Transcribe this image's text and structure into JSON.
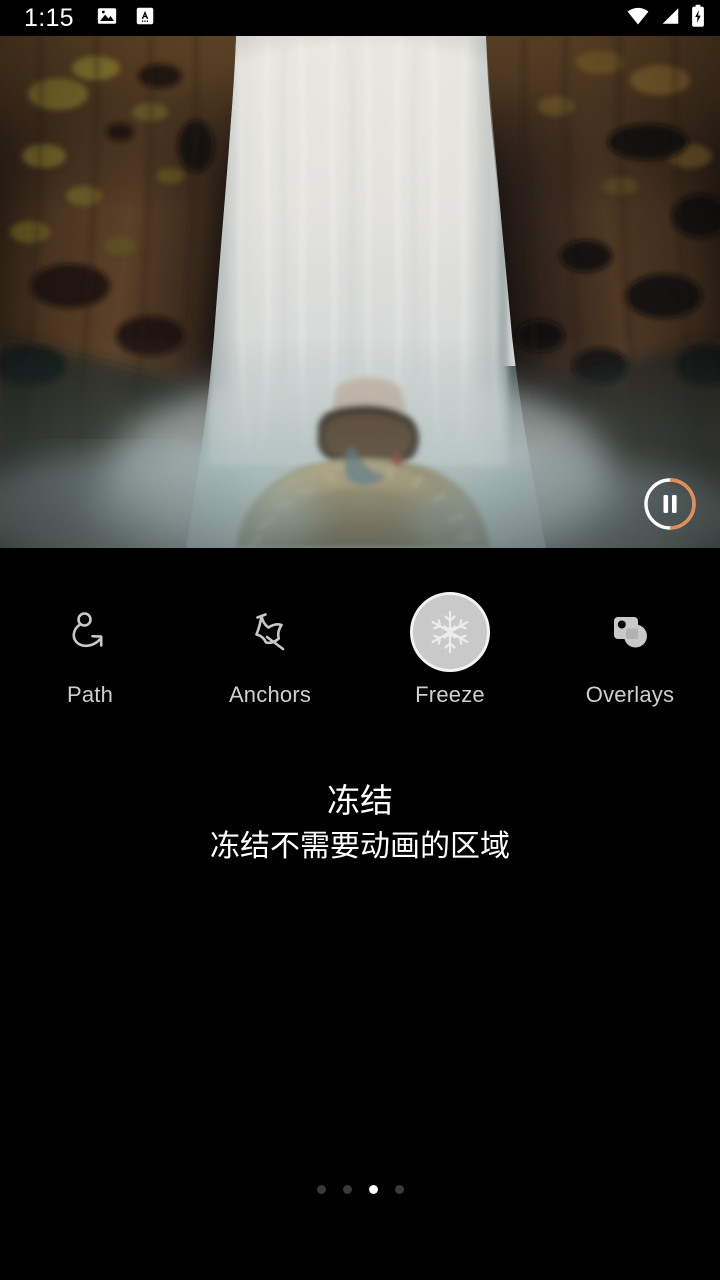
{
  "status_bar": {
    "time": "1:15",
    "left_icons": [
      "image-icon",
      "screenshot-a-icon"
    ],
    "right_icons": [
      "wifi-icon",
      "cellular-signal-icon",
      "battery-charging-icon"
    ]
  },
  "preview": {
    "scene_description": "waterfall between dark basalt cliffs with a person in a fur-hooded parka",
    "playback": {
      "state_icon": "pause-icon",
      "progress_percent": 62,
      "ring_color": "#ffffff",
      "progress_color": "#e08c53"
    }
  },
  "toolbar": {
    "tools": [
      {
        "id": "path",
        "label": "Path",
        "icon": "path-loop-arrow-icon",
        "selected": false
      },
      {
        "id": "anchors",
        "label": "Anchors",
        "icon": "pushpin-icon",
        "selected": false
      },
      {
        "id": "freeze",
        "label": "Freeze",
        "icon": "snowflake-icon",
        "selected": true
      },
      {
        "id": "overlays",
        "label": "Overlays",
        "icon": "square-circle-overlay-icon",
        "selected": false
      }
    ],
    "selected_id": "freeze",
    "icon_color": "#c9c9c9",
    "label_color": "#cfcfcf",
    "selected_bg": "#c9c9c9"
  },
  "description": {
    "title": "冻结",
    "subtitle": "冻结不需要动画的区域"
  },
  "pager": {
    "total": 4,
    "active_index": 2,
    "active_color": "#ffffff",
    "inactive_color": "#3a3a3a"
  }
}
